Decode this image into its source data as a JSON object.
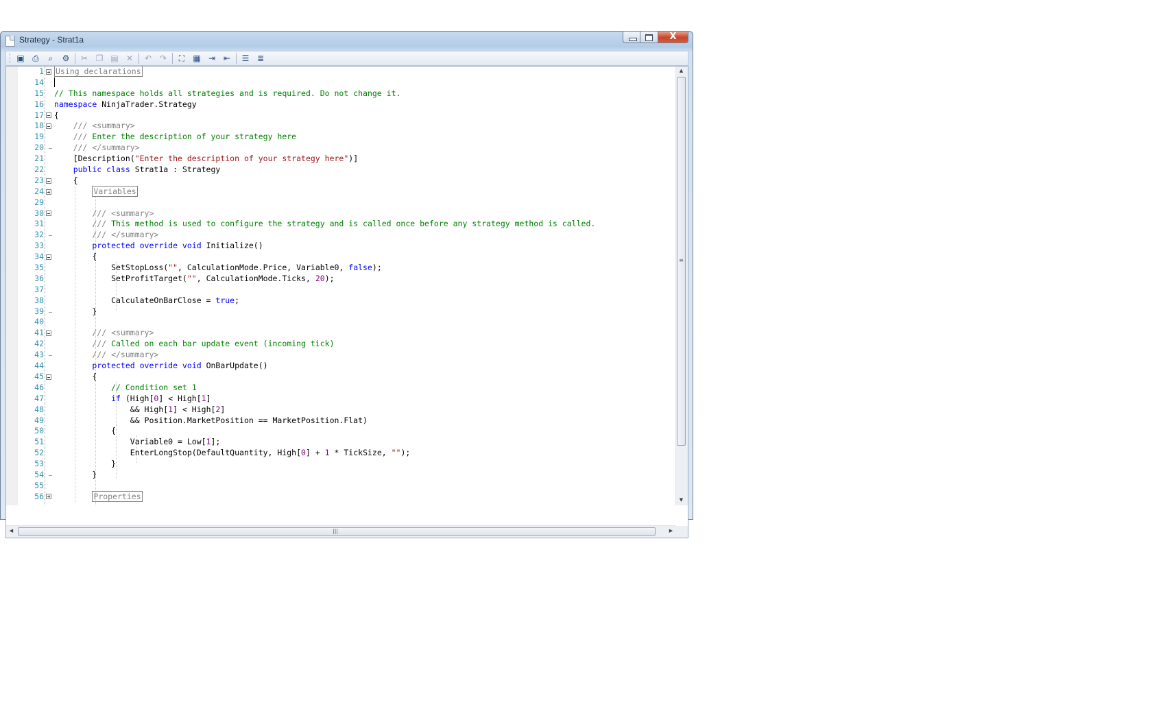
{
  "window": {
    "title": "Strategy - Strat1a",
    "min_label": "minimize",
    "max_label": "maximize",
    "close_label": "X"
  },
  "toolbar": {
    "buttons": [
      {
        "icon": "save-icon",
        "glyph": "▣"
      },
      {
        "icon": "print-icon",
        "glyph": "⎙"
      },
      {
        "icon": "print-preview-icon",
        "glyph": "⌕"
      },
      {
        "icon": "compile-icon",
        "glyph": "⚙"
      },
      {
        "icon": "cut-icon",
        "glyph": "✂"
      },
      {
        "icon": "copy-icon",
        "glyph": "❐"
      },
      {
        "icon": "paste-icon",
        "glyph": "▤"
      },
      {
        "icon": "delete-icon",
        "glyph": "✕"
      },
      {
        "icon": "undo-icon",
        "glyph": "↶"
      },
      {
        "icon": "redo-icon",
        "glyph": "↷"
      },
      {
        "icon": "find-icon",
        "glyph": "⛶"
      },
      {
        "icon": "replace-icon",
        "glyph": "▦"
      },
      {
        "icon": "indent-icon",
        "glyph": "⇥"
      },
      {
        "icon": "outdent-icon",
        "glyph": "⇤"
      },
      {
        "icon": "comment-icon",
        "glyph": "☰"
      },
      {
        "icon": "uncomment-icon",
        "glyph": "≣"
      }
    ]
  },
  "editor": {
    "line_numbers": [
      "1",
      "14",
      "15",
      "16",
      "17",
      "18",
      "19",
      "20",
      "21",
      "22",
      "23",
      "24",
      "29",
      "30",
      "31",
      "32",
      "33",
      "34",
      "35",
      "36",
      "37",
      "38",
      "39",
      "40",
      "41",
      "42",
      "43",
      "44",
      "45",
      "46",
      "47",
      "48",
      "49",
      "50",
      "51",
      "52",
      "53",
      "54",
      "55",
      "56"
    ],
    "collapsed": {
      "using": "Using declarations",
      "variables": "Variables",
      "properties": "Properties"
    },
    "code": {
      "l15": "// This namespace holds all strategies and is required. Do not change it.",
      "l16_kw": "namespace",
      "l16_rest": " NinjaTrader.Strategy",
      "l17": "{",
      "l18": "    /// <summary>",
      "l19_a": "    /// ",
      "l19_b": "Enter the description of your strategy here",
      "l20": "    /// </summary>",
      "l21_a": "    [Description(",
      "l21_b": "\"Enter the description of your strategy here\"",
      "l21_c": ")]",
      "l22_kw": "    public class",
      "l22_rest": " Strat1a : Strategy",
      "l23": "    {",
      "l24_indent": "        ",
      "l30": "        /// <summary>",
      "l31_a": "        /// ",
      "l31_b": "This method is used to configure the strategy and is called once before any strategy method is called.",
      "l32": "        /// </summary>",
      "l33_kw": "        protected override void",
      "l33_rest": " Initialize()",
      "l34": "        {",
      "l35_a": "            SetStopLoss(",
      "l35_b": "\"\"",
      "l35_c": ", CalculationMode.Price, Variable0, ",
      "l35_d": "false",
      "l35_e": ");",
      "l36_a": "            SetProfitTarget(",
      "l36_b": "\"\"",
      "l36_c": ", CalculationMode.Ticks, ",
      "l36_d": "20",
      "l36_e": ");",
      "l38_a": "            CalculateOnBarClose = ",
      "l38_b": "true",
      "l38_c": ";",
      "l39": "        }",
      "l41": "        /// <summary>",
      "l42_a": "        /// ",
      "l42_b": "Called on each bar update event (incoming tick)",
      "l43": "        /// </summary>",
      "l44_kw": "        protected override void",
      "l44_rest": " OnBarUpdate()",
      "l45": "        {",
      "l46": "            // Condition set 1",
      "l47_kw": "            if",
      "l47_a": " (High[",
      "l47_n1": "0",
      "l47_b": "] < High[",
      "l47_n2": "1",
      "l47_c": "]",
      "l48_a": "                && High[",
      "l48_n1": "1",
      "l48_b": "] < High[",
      "l48_n2": "2",
      "l48_c": "]",
      "l49": "                && Position.MarketPosition == MarketPosition.Flat)",
      "l50": "            {",
      "l51_a": "                Variable0 = Low[",
      "l51_n": "1",
      "l51_b": "];",
      "l52_a": "                EnterLongStop(DefaultQuantity, High[",
      "l52_n1": "0",
      "l52_b": "] + ",
      "l52_n2": "1",
      "l52_c": " * TickSize, ",
      "l52_d": "\"\"",
      "l52_e": ");",
      "l53": "            }",
      "l54": "        }"
    }
  },
  "colors": {
    "comment": "#008000",
    "keyword": "#0000ff",
    "string": "#a31515",
    "number": "#800080",
    "line_number": "#2b91af"
  }
}
